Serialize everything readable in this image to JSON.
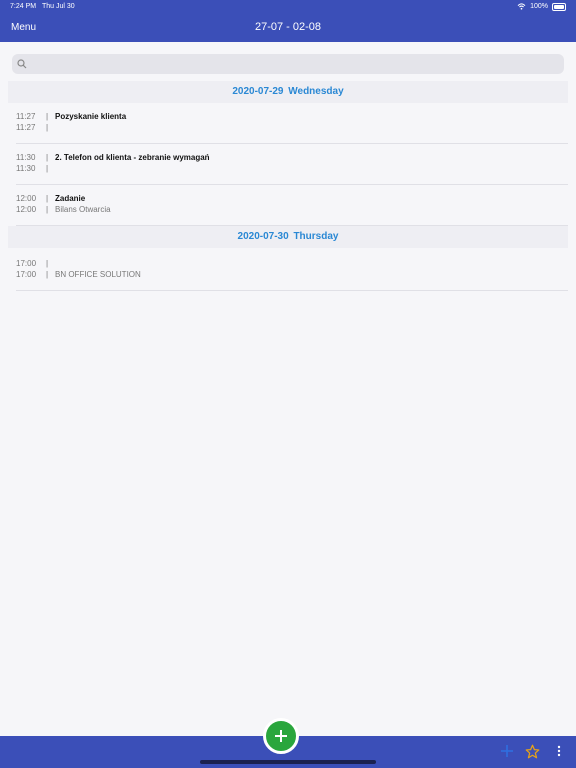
{
  "status_bar": {
    "time": "7:24 PM",
    "date": "Thu Jul 30",
    "battery": "100%"
  },
  "nav": {
    "menu_label": "Menu",
    "title": "27-07 - 02-08"
  },
  "search": {
    "placeholder": ""
  },
  "days": [
    {
      "header": "2020-07-29  Wednesday",
      "entries": [
        {
          "start": "11:27",
          "end": "11:27",
          "title": "Pozyskanie  klienta",
          "subtitle": ""
        },
        {
          "start": "11:30",
          "end": "11:30",
          "title": "2. Telefon od klienta - zebranie wymagań",
          "subtitle": ""
        },
        {
          "start": "12:00",
          "end": "12:00",
          "title": "Zadanie",
          "subtitle": "Bilans Otwarcia"
        }
      ]
    },
    {
      "header": "2020-07-30  Thursday",
      "entries": [
        {
          "start": "17:00",
          "end": "17:00",
          "title": "",
          "subtitle": "BN OFFICE SOLUTION"
        }
      ]
    }
  ],
  "separator": "|",
  "icons": {
    "search": "search-icon",
    "add": "plus-icon",
    "favorite": "star-icon",
    "more": "more-vertical-icon",
    "wifi": "wifi-icon",
    "battery": "battery-icon"
  },
  "colors": {
    "bar": "#3b4fb8",
    "accent_text": "#2a88d4",
    "fab": "#2aa63d",
    "star": "#e8a317"
  }
}
